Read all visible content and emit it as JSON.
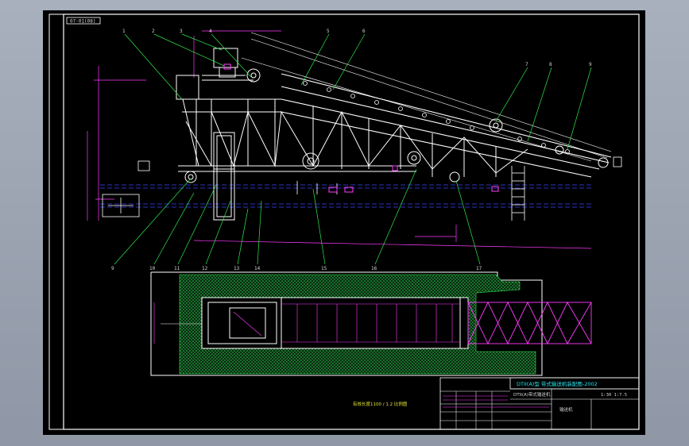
{
  "window": {
    "background": "#8f97a6",
    "paper_color": "#000000"
  },
  "drawing": {
    "sheet_code": "07-01(08)",
    "title_line": "DTII(A)型 带式输送机装配图-2002",
    "drawing_number": "DTII(A)带式输送机",
    "scale_note": "1:30  1:7.5",
    "note": "有效长度1100 / 1.2 比例图",
    "unit_name": "输送机",
    "callouts_top": [
      "1",
      "2",
      "3",
      "4",
      "5",
      "6",
      "7",
      "8",
      "9"
    ],
    "callouts_bottom": [
      "9",
      "10",
      "11",
      "12",
      "13",
      "14",
      "15",
      "16",
      "17"
    ]
  },
  "colors": {
    "structure": "#ffffff",
    "leaders": "#2ee84a",
    "centerlines": "#3a45ff",
    "dimensions": "#ff3bff",
    "hatching": "#1bd04a",
    "title_text": "#29e3ef"
  }
}
